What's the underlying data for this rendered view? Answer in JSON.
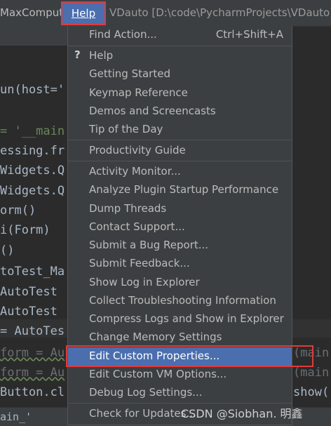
{
  "menubar": {
    "left_item": "MaxCompute",
    "help_label": "Help",
    "title": "VDauto [D:\\code\\PycharmProjects\\VDauto]"
  },
  "editor": {
    "lines": [
      "un(host='",
      "= '__main",
      "essing.fr",
      "Widgets.Q",
      "Widgets.Q",
      "orm()",
      "i(Form)",
      "()",
      "toTest_Ma",
      " AutoTest",
      " AutoTest",
      "= AutoTes",
      "form = Au",
      "form = Au",
      "Button.cl"
    ],
    "right_fragments": [
      "(main",
      "(main",
      "show("
    ],
    "bottom_tab": "ain_'"
  },
  "menu": {
    "find_action": {
      "label": "Find Action...",
      "shortcut": "Ctrl+Shift+A"
    },
    "items": [
      {
        "label": "Help"
      },
      {
        "label": "Getting Started"
      },
      {
        "label": "Keymap Reference"
      },
      {
        "label": "Demos and Screencasts"
      },
      {
        "label": "Tip of the Day"
      },
      {
        "label": "Productivity Guide"
      },
      {
        "label": "Activity Monitor..."
      },
      {
        "label": "Analyze Plugin Startup Performance"
      },
      {
        "label": "Dump Threads"
      },
      {
        "label": "Contact Support..."
      },
      {
        "label": "Submit a Bug Report..."
      },
      {
        "label": "Submit Feedback..."
      },
      {
        "label": "Show Log in Explorer"
      },
      {
        "label": "Collect Troubleshooting Information"
      },
      {
        "label": "Compress Logs and Show in Explorer"
      },
      {
        "label": "Change Memory Settings"
      },
      {
        "label": "Edit Custom Properties..."
      },
      {
        "label": "Edit Custom VM Options..."
      },
      {
        "label": "Debug Log Settings..."
      },
      {
        "label": "Check for Updates..."
      }
    ]
  },
  "watermark": "CSDN @Siobhan. 明鑫",
  "colors": {
    "menu_bg": "#3c3f41",
    "selection": "#4b6eaf",
    "annotation_red": "#e03a3a",
    "editor_bg": "#2b2b2b"
  }
}
